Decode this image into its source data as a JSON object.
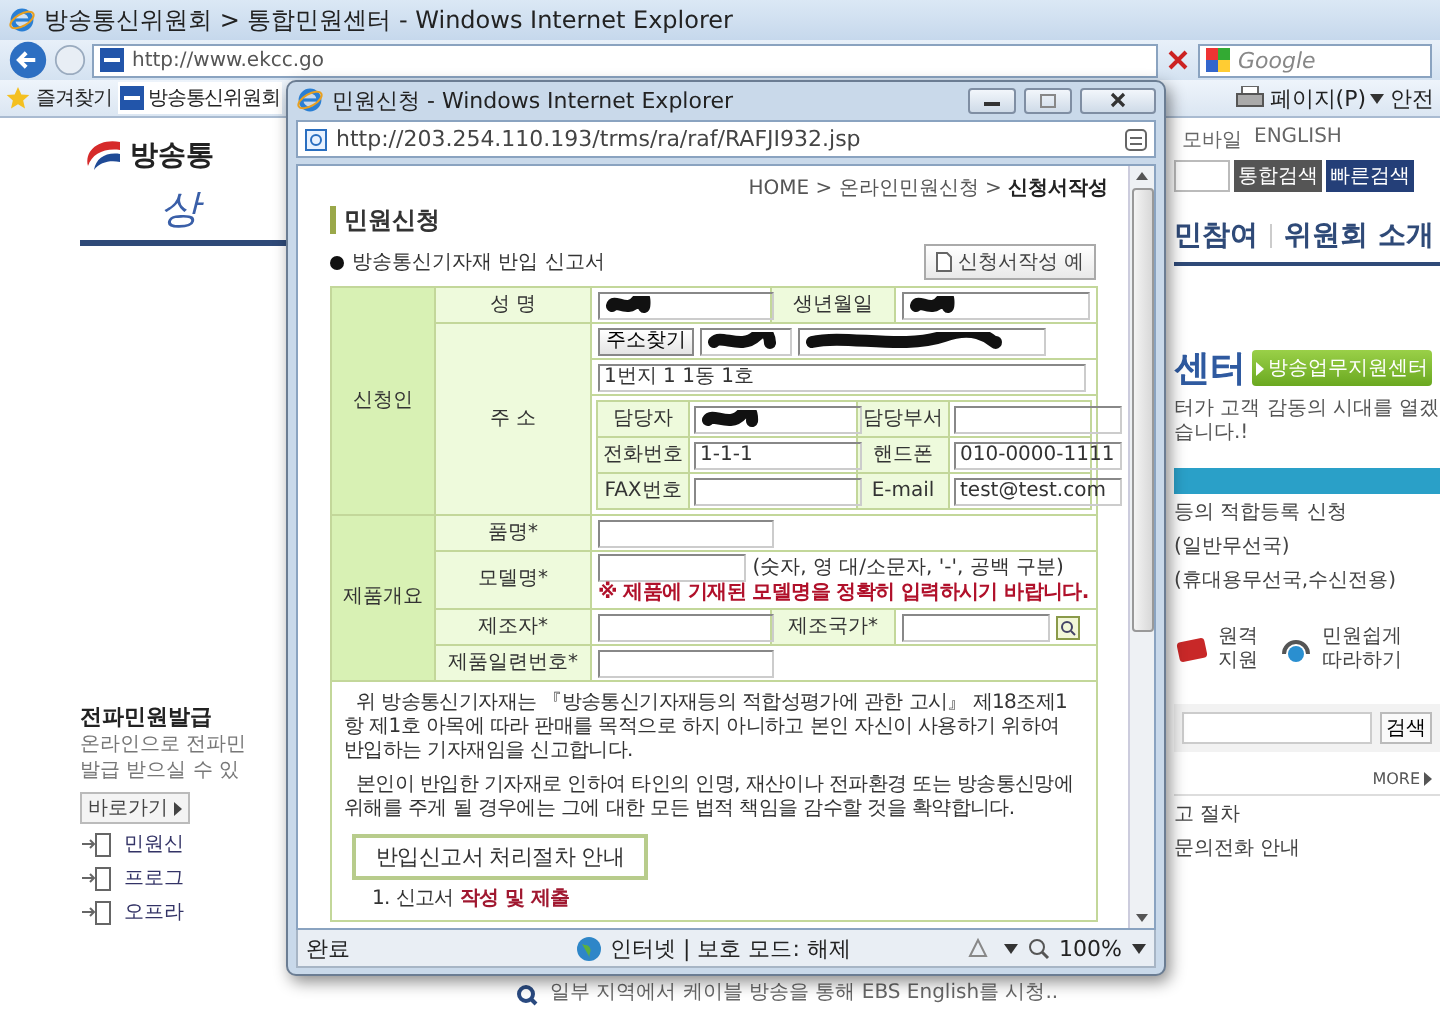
{
  "browser": {
    "title": "방송통신위원회 > 통합민원센터 - Windows Internet Explorer",
    "address": "http://www.ekcc.go",
    "search_placeholder": "Google",
    "favorites": "즐겨찾기",
    "tab": "방송통신위원회",
    "page_menu": "페이지(P)",
    "safety_menu": "안전"
  },
  "site": {
    "logo": "방송통",
    "slogan": "상",
    "top_links": [
      "모바일",
      "ENGLISH"
    ],
    "search_buttons": [
      "통합검색",
      "빠른검색"
    ],
    "nav": [
      "민참여",
      "위원회 소개"
    ],
    "hero_title": "센터",
    "hero_button": "방송업무지원센터",
    "hero_text": "터가 고객 감동의 시대를 열겠습니다.!",
    "list_items": [
      "등의 적합등록 신청",
      "(일반무선국)",
      "(휴대용무선국,수신전용)"
    ],
    "quick_links": [
      "원격 지원",
      "민원쉽게 따라하기"
    ],
    "search_button": "검색",
    "more": "MORE",
    "notice_items": [
      "고 절차",
      "문의전화 안내"
    ],
    "left_title": "전파민원발급",
    "left_text": [
      "온라인으로 전파민",
      "발급 받으실 수 있"
    ],
    "left_button": "바로가기",
    "left_links": [
      "민원신",
      "프로그",
      "오프라"
    ],
    "bottom_notice": "일부 지역에서 케이블 방송을 통해 EBS English를 시청.."
  },
  "popup": {
    "title": "민원신청 - Windows Internet Explorer",
    "address": "http://203.254.110.193/trms/ra/raf/RAFJI932.jsp",
    "breadcrumb": "HOME > 온라인민원신청 > **신청서작성**",
    "heading": "민원신청",
    "form_title": "방송통신기자재 반입 신고서",
    "example_button": "신청서작성 예",
    "applicant": {
      "label": "신청인",
      "name": {
        "label": "성 명",
        "redacted": true
      },
      "birth": {
        "label": "생년월일",
        "redacted": true
      },
      "address": {
        "label": "주 소",
        "search_button": "주소찾기",
        "fields": [
          {
            "redacted": true
          },
          {
            "redacted": true
          },
          {
            "redacted": false,
            "value": "1번지 1 1동 1호"
          }
        ]
      },
      "contact": [
        {
          "label": "담당자",
          "redacted": true
        },
        {
          "label": "담당부서",
          "redacted": false
        },
        {
          "label": "전화번호",
          "redacted": false,
          "value": "1-1-1"
        },
        {
          "label": "핸드폰",
          "redacted": false,
          "value": "010-0000-1111"
        },
        {
          "label": "FAX번호",
          "redacted": false
        },
        {
          "label": "E-mail",
          "redacted": false,
          "value": "test@test.com"
        }
      ]
    },
    "product": {
      "label": "제품개요",
      "name_label": "품명*",
      "model_label": "모델명*",
      "model_hint": "(숫자, 영 대/소문자, '-', 공백 구분)",
      "model_warning": "※ 제품에 기재된 모델명을 정확히 입력하시기 바랍니다.",
      "maker_label": "제조자*",
      "country_label": "제조국가*",
      "serial_label": "제품일련번호*"
    },
    "declaration": [
      "위 방송통신기자재는 『방송통신기자재등의 적합성평가에 관한 고시』 제18조제1항 제1호 아목에 따라 판매를 목적으로 하지 아니하고 본인 자신이 사용하기 위하여 반입하는 기자재임을 신고합니다.",
      "본인이 반입한 기자재로 인하여 타인의 인명, 재산이나 전파환경 또는 방송통신망에 위해를 주게 될 경우에는 그에 대한 모든 법적 책임을 감수할 것을 확약합니다."
    ],
    "procedure_title": "반입신고서 처리절차 안내",
    "procedure_step": "1. 신고서 **작성 및 제출**",
    "status": {
      "text": "완료",
      "zone": "인터넷 | 보호 모드: 해제",
      "zoom": "100%"
    }
  }
}
